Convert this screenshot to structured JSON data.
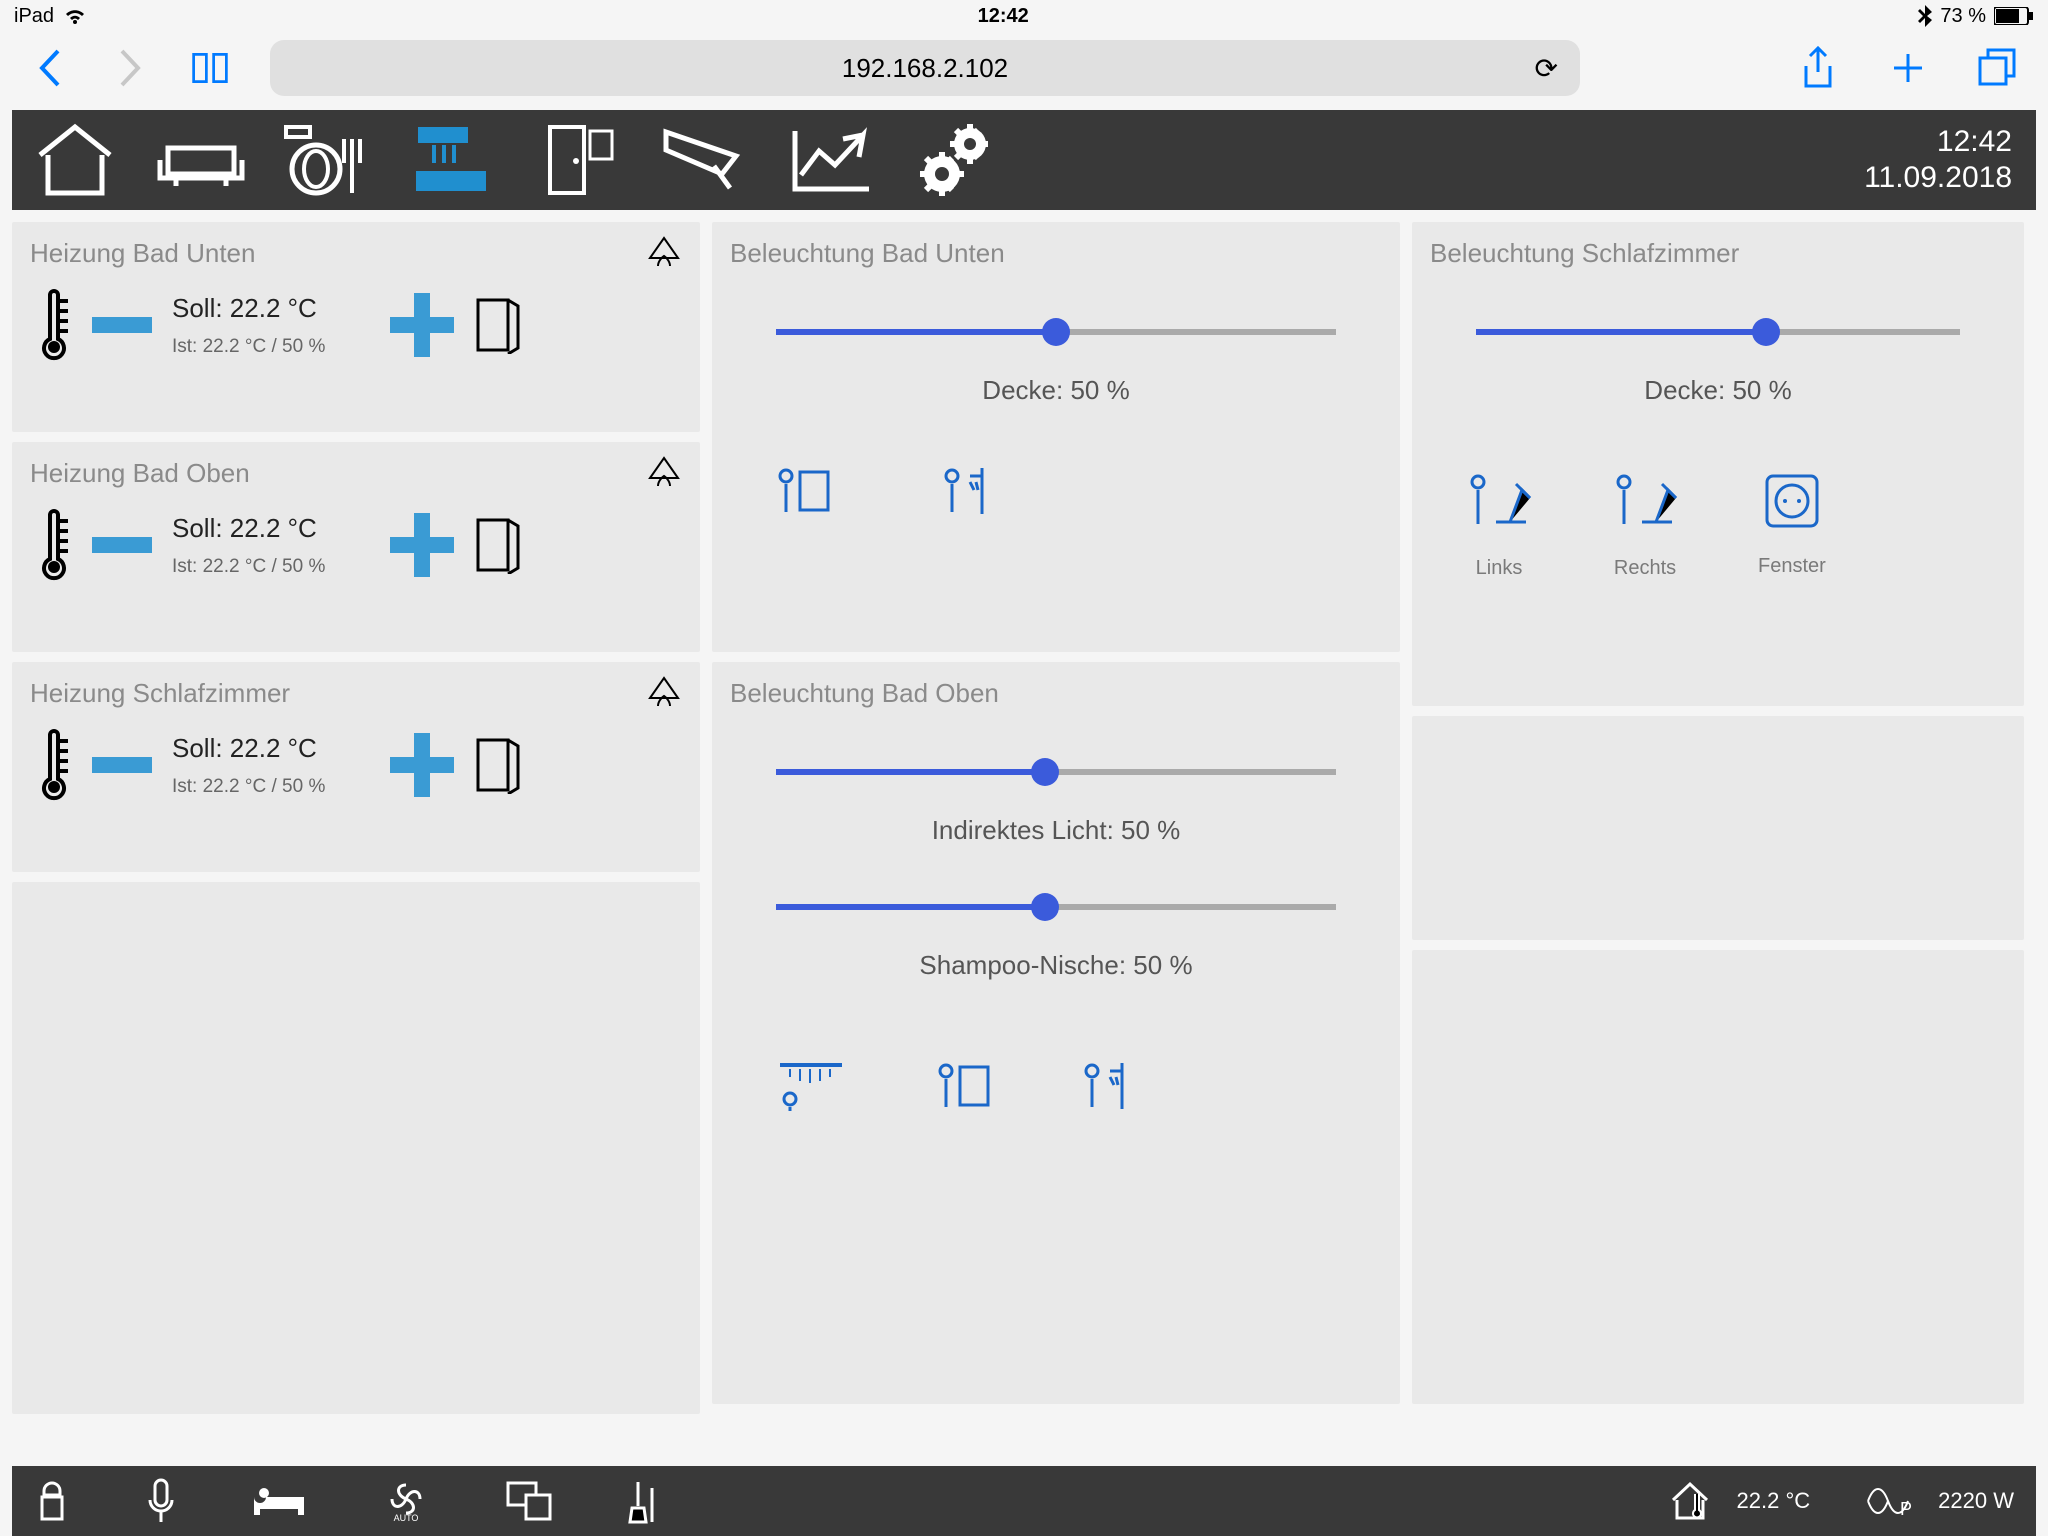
{
  "status": {
    "device": "iPad",
    "time": "12:42",
    "bt": "73 %"
  },
  "safari": {
    "url": "192.168.2.102"
  },
  "nav_dt": {
    "time": "12:42",
    "date": "11.09.2018"
  },
  "heating": [
    {
      "title": "Heizung Bad Unten",
      "soll": "Soll: 22.2 °C",
      "ist": "Ist: 22.2 °C /  50 %"
    },
    {
      "title": "Heizung Bad Oben",
      "soll": "Soll: 22.2 °C",
      "ist": "Ist: 22.2 °C /  50 %"
    },
    {
      "title": "Heizung Schlafzimmer",
      "soll": "Soll: 22.2 °C",
      "ist": "Ist: 22.2 °C /  50 %"
    }
  ],
  "light_bu": {
    "title": "Beleuchtung Bad Unten",
    "label": "Decke:  50 %",
    "pct": 50
  },
  "light_bo": {
    "title": "Beleuchtung Bad Oben",
    "s1_label": "Indirektes Licht:  50 %",
    "s1_pct": 48,
    "s2_label": "Shampoo-Nische:  50 %",
    "s2_pct": 48
  },
  "light_sz": {
    "title": "Beleuchtung Schlafzimmer",
    "label": "Decke:  50 %",
    "pct": 60,
    "i1": "Links",
    "i2": "Rechts",
    "i3": "Fenster"
  },
  "footer": {
    "temp": "22.2 °C",
    "power": "2220 W"
  }
}
